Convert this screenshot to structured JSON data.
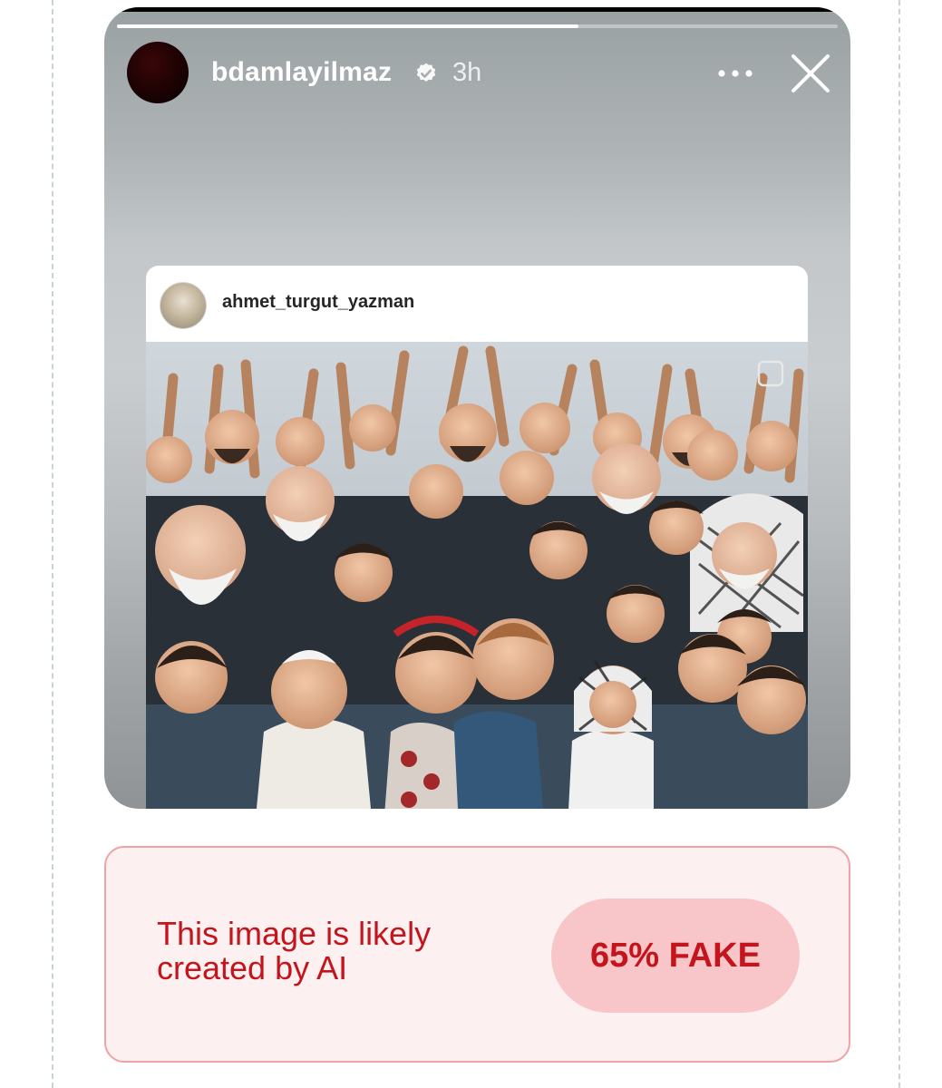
{
  "story": {
    "username": "bdamlayilmaz",
    "time": "3h",
    "progress_fraction": 0.64,
    "icons": {
      "verified": "verified-badge-icon",
      "more": "more-options-icon",
      "close": "close-icon"
    }
  },
  "shared_post": {
    "username": "ahmet_turgut_yazman",
    "photo": "group-photo"
  },
  "verdict": {
    "message": "This image is likely created by AI",
    "badge": "65% FAKE",
    "text_color": "#c4141c",
    "badge_color": "#f8c6c8",
    "border_color": "#f0a3a5",
    "background_color": "#fcf0f1"
  }
}
